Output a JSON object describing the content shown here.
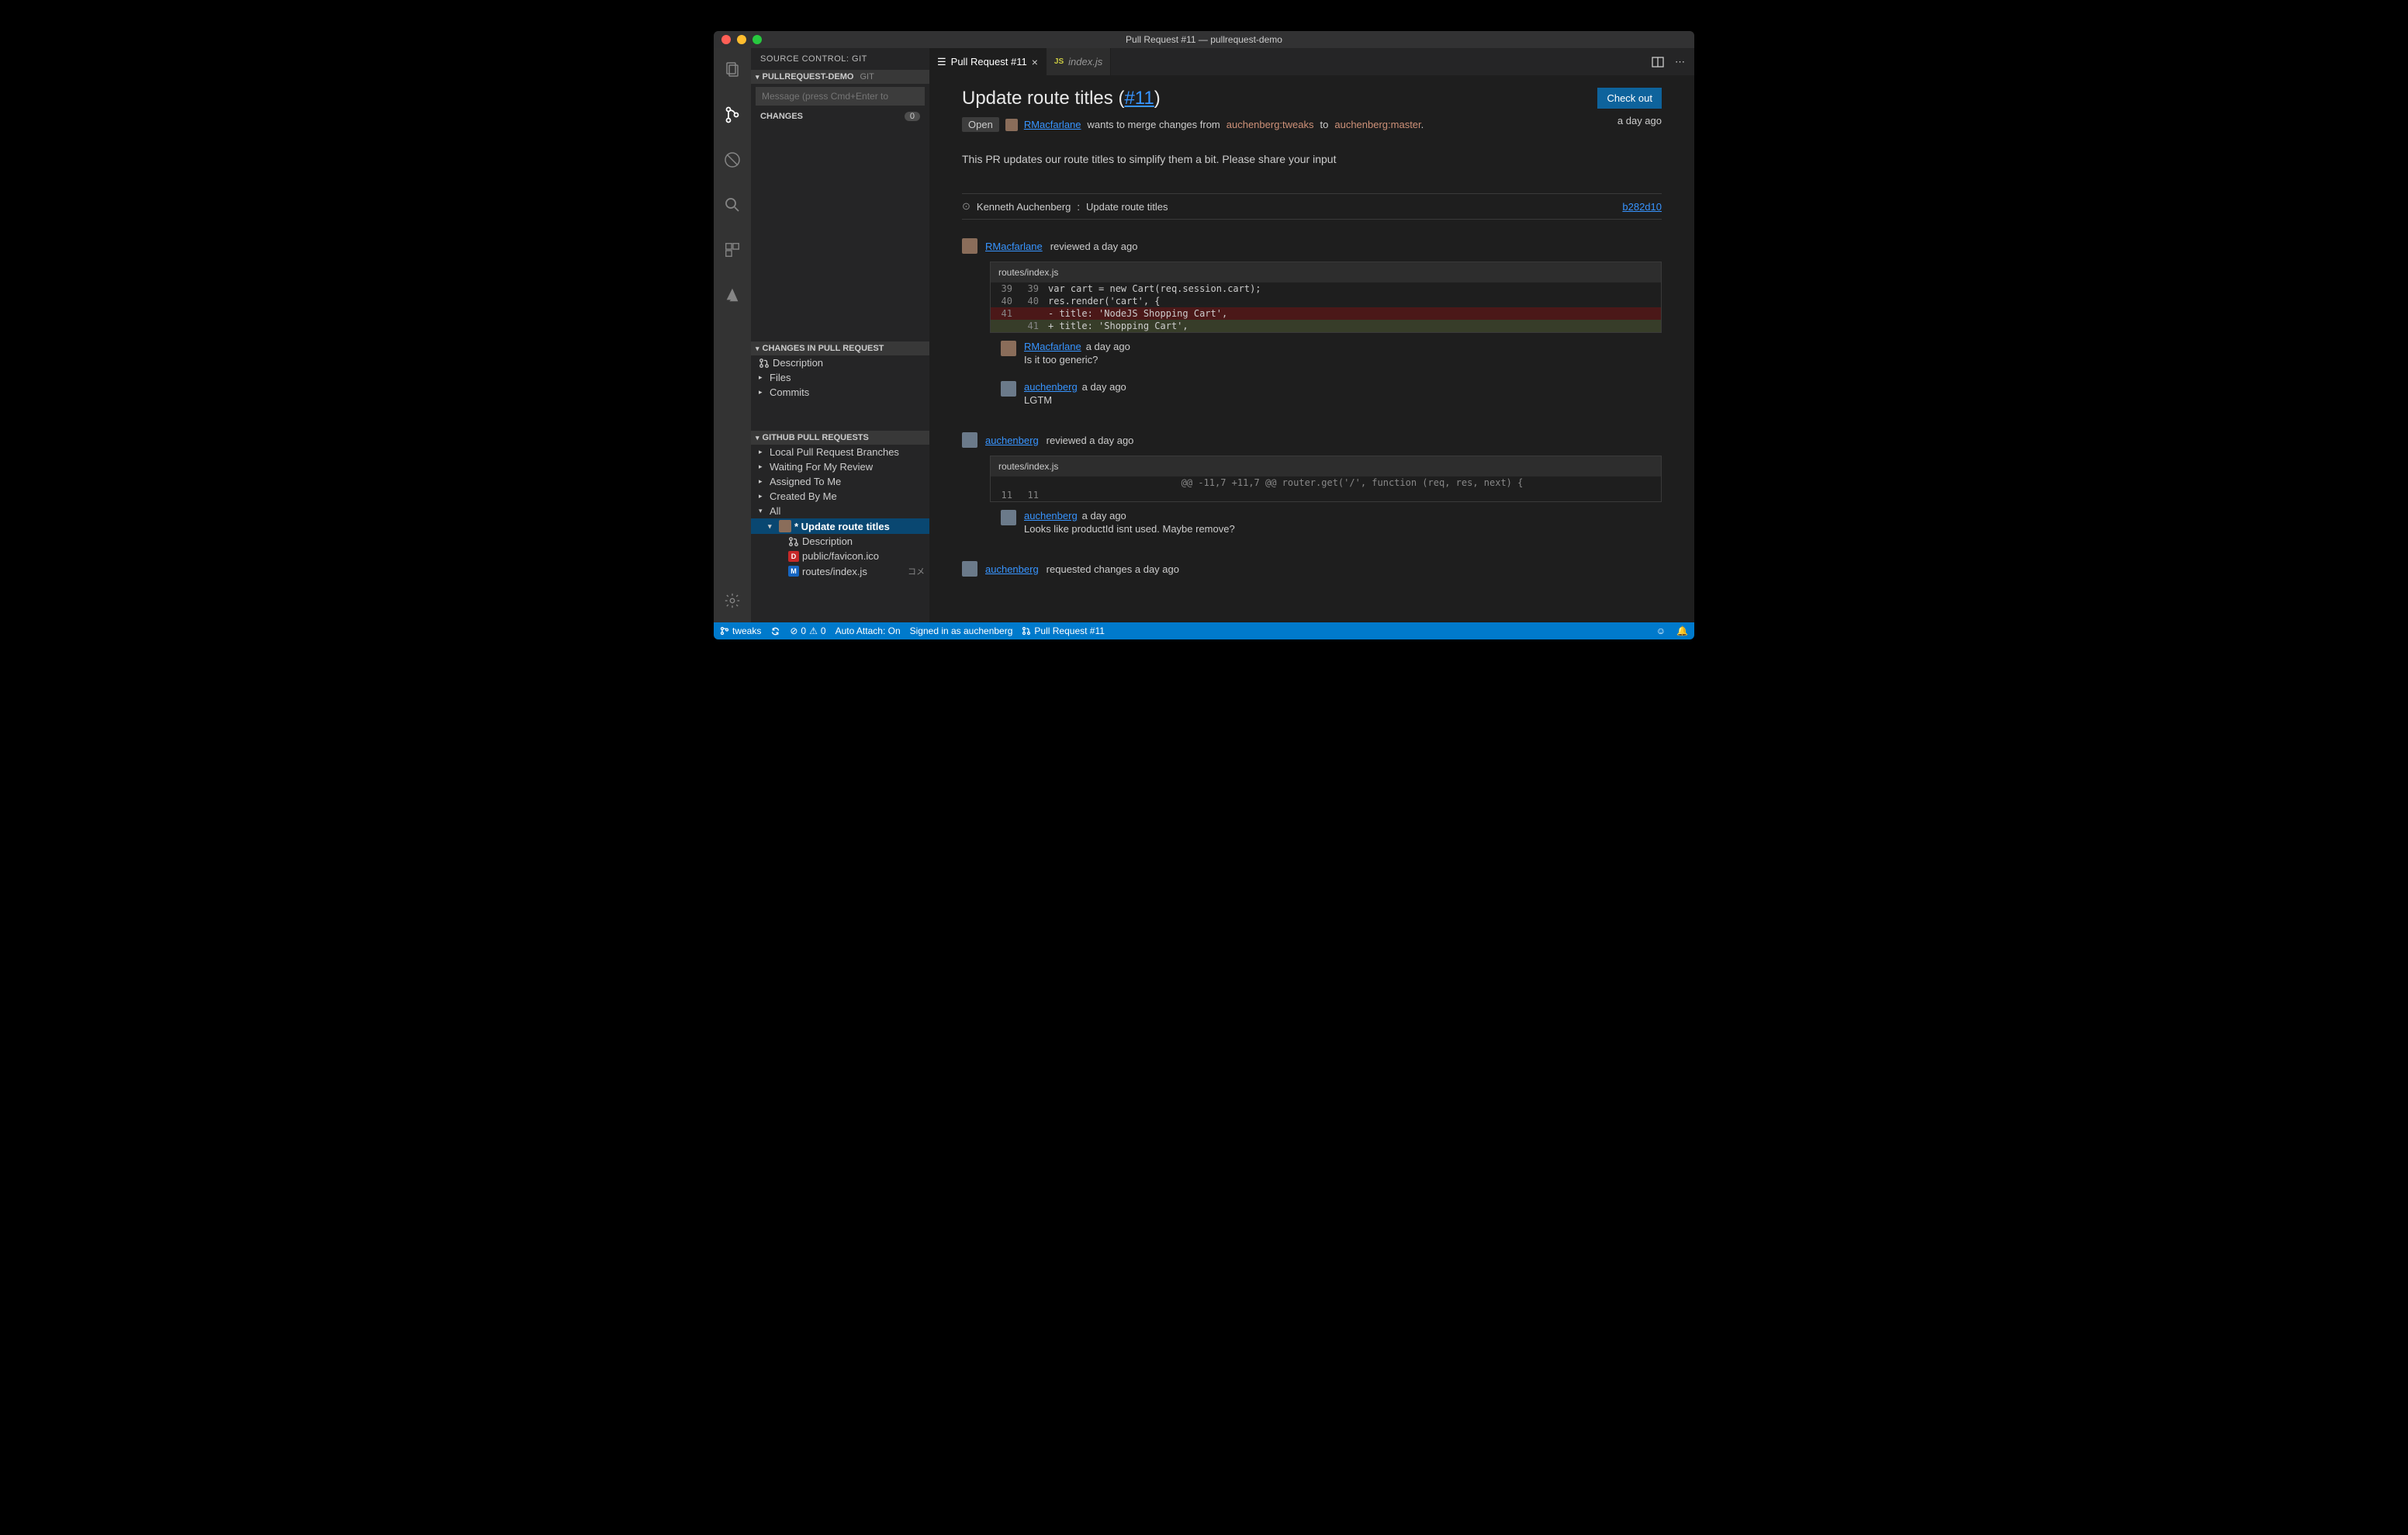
{
  "titlebar": {
    "title": "Pull Request #11 — pullrequest-demo"
  },
  "sidebar": {
    "header": "SOURCE CONTROL: GIT",
    "repo_section": {
      "label": "PULLREQUEST-DEMO",
      "provider": "GIT"
    },
    "message_placeholder": "Message (press Cmd+Enter to",
    "changes_label": "CHANGES",
    "changes_count": "0",
    "changes_in_pr_label": "CHANGES IN PULL REQUEST",
    "changes_in_pr": [
      {
        "label": "Description"
      },
      {
        "label": "Files"
      },
      {
        "label": "Commits"
      }
    ],
    "gprs_label": "GITHUB PULL REQUESTS",
    "gprs": [
      {
        "label": "Local Pull Request Branches",
        "expanded": false
      },
      {
        "label": "Waiting For My Review",
        "expanded": false
      },
      {
        "label": "Assigned To Me",
        "expanded": false
      },
      {
        "label": "Created By Me",
        "expanded": false
      },
      {
        "label": "All",
        "expanded": true
      }
    ],
    "gprs_all": {
      "pr_label": "* Update route titles",
      "children": [
        {
          "icon": "pr",
          "label": "Description"
        },
        {
          "icon": "d",
          "label": "public/favicon.ico"
        },
        {
          "icon": "m",
          "label": "routes/index.js",
          "status": "コメ"
        }
      ]
    }
  },
  "tabs": [
    {
      "label": "Pull Request #11",
      "active": true,
      "icon": "pr"
    },
    {
      "label": "index.js",
      "active": false,
      "icon": "js"
    }
  ],
  "pr": {
    "title": "Update route titles",
    "number": "#11",
    "checkout_label": "Check out",
    "status": "Open",
    "author": "RMacfarlane",
    "merge_text_1": "wants to merge changes from",
    "source_branch": "auchenberg:tweaks",
    "merge_text_2": "to",
    "target_branch": "auchenberg:master",
    "time": "a day ago",
    "description": "This PR updates our route titles to simplify them a bit. Please share your input",
    "commit": {
      "author": "Kenneth Auchenberg",
      "message": "Update route titles",
      "sha": "b282d10"
    },
    "reviews": [
      {
        "user": "RMacfarlane",
        "action": "reviewed a day ago",
        "file": "routes/index.js",
        "diff": [
          {
            "old": "39",
            "new": "39",
            "kind": "ctx",
            "text": "var cart = new Cart(req.session.cart);"
          },
          {
            "old": "40",
            "new": "40",
            "kind": "ctx",
            "text": "res.render('cart', {"
          },
          {
            "old": "41",
            "new": "",
            "kind": "del",
            "text": "- title: 'NodeJS Shopping Cart',"
          },
          {
            "old": "",
            "new": "41",
            "kind": "add",
            "text": "+ title: 'Shopping Cart',"
          }
        ],
        "comments": [
          {
            "user": "RMacfarlane",
            "time": "a day ago",
            "body": "Is it too generic?"
          },
          {
            "user": "auchenberg",
            "time": "a day ago",
            "body": "LGTM"
          }
        ]
      },
      {
        "user": "auchenberg",
        "action": "reviewed a day ago",
        "file": "routes/index.js",
        "hunk": "@@ -11,7 +11,7 @@ router.get('/', function (req, res, next) {",
        "diff": [
          {
            "old": "11",
            "new": "11",
            "kind": "ctx",
            "text": ""
          }
        ],
        "comments": [
          {
            "user": "auchenberg",
            "time": "a day ago",
            "body": "Looks like productId isnt used. Maybe remove?"
          }
        ]
      }
    ],
    "footer_event": {
      "user": "auchenberg",
      "action": "requested changes a day ago"
    }
  },
  "statusbar": {
    "branch": "tweaks",
    "errors": "0",
    "warnings": "0",
    "auto_attach": "Auto Attach: On",
    "signed_in": "Signed in as auchenberg",
    "pr_context": "Pull Request #11"
  }
}
